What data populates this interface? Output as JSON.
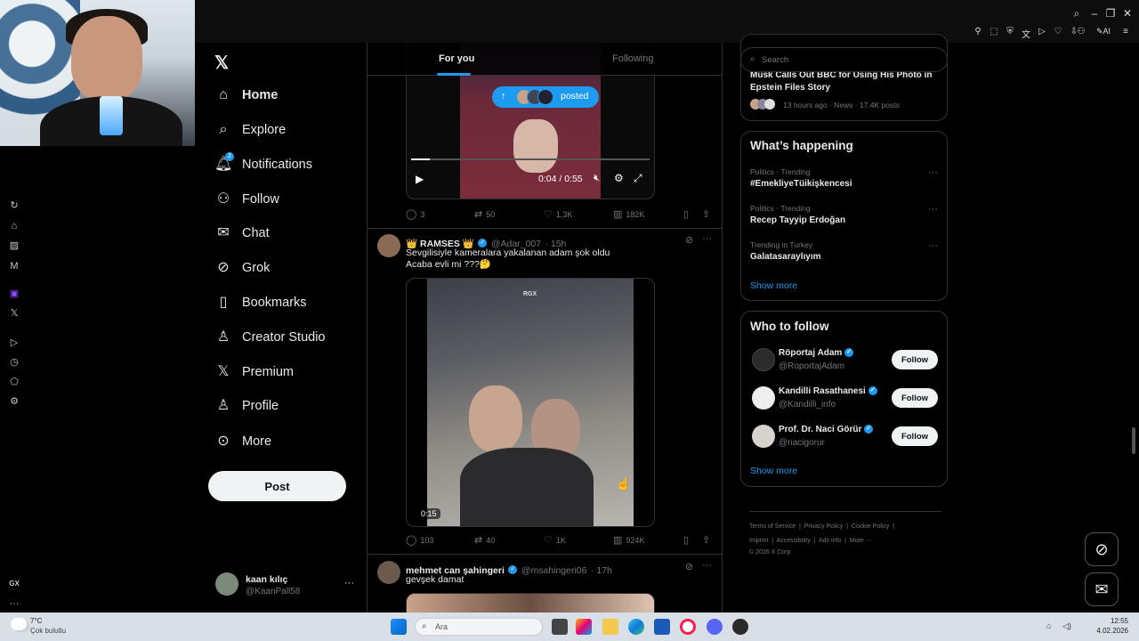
{
  "nav": {
    "items": [
      {
        "label": "Home",
        "icon": "home-icon"
      },
      {
        "label": "Explore",
        "icon": "search-icon"
      },
      {
        "label": "Notifications",
        "icon": "bell-icon",
        "badge": "2"
      },
      {
        "label": "Follow",
        "icon": "follow-icon"
      },
      {
        "label": "Chat",
        "icon": "chat-icon"
      },
      {
        "label": "Grok",
        "icon": "grok-icon"
      },
      {
        "label": "Bookmarks",
        "icon": "bookmark-icon"
      },
      {
        "label": "Creator Studio",
        "icon": "creator-studio-icon"
      },
      {
        "label": "Premium",
        "icon": "x-logo-icon"
      },
      {
        "label": "Profile",
        "icon": "profile-icon"
      },
      {
        "label": "More",
        "icon": "more-circle-icon"
      }
    ],
    "post_label": "Post",
    "account": {
      "name": "kaan kılıç",
      "handle": "@KaanPall58"
    }
  },
  "feed": {
    "tabs": [
      "For you",
      "Following"
    ],
    "posted_pill": "posted",
    "video1": {
      "time": "0:04 / 0:55",
      "progress": 0.08
    },
    "tweet1_actions": {
      "replies": "3",
      "reposts": "50",
      "likes": "1,3K",
      "views": "182K"
    },
    "tweet2": {
      "name": "👑 RAMSES 👑",
      "handle": "@Adar_007",
      "time": "· 15h",
      "text_line1": "Sevgilisiyle kameralara yakalanan adam şok oldu",
      "text_line2": "Acaba evli mi ???🤔",
      "watermark": "RGX",
      "duration": "0:15",
      "actions": {
        "replies": "103",
        "reposts": "40",
        "likes": "1K",
        "views": "924K"
      }
    },
    "tweet3": {
      "name": "mehmet can şahingeri",
      "handle": "@msahingeri06",
      "time": "· 17h",
      "text": "gevşek damat"
    }
  },
  "right": {
    "search_placeholder": "Search",
    "top_story": {
      "title_line1": "Musk Calls Out BBC for Using His Photo in",
      "title_line2": "Epstein Files Story",
      "meta": "13 hours ago · News · 17.4K posts"
    },
    "happening": {
      "title": "What’s happening",
      "trends": [
        {
          "context": "Politics · Trending",
          "name": "#EmekliyeTüikişkencesi"
        },
        {
          "context": "Politics · Trending",
          "name": "Recep Tayyip Erdoğan"
        },
        {
          "context": "Trending in Turkey",
          "name": "Galatasaraylıyım"
        }
      ],
      "show_more": "Show more"
    },
    "who_to_follow": {
      "title": "Who to follow",
      "users": [
        {
          "name": "Röportaj Adam",
          "handle": "@RoportajAdam",
          "button": "Follow"
        },
        {
          "name": "Kandilli Rasathanesi",
          "handle": "@Kandilli_info",
          "button": "Follow"
        },
        {
          "name": "Prof. Dr. Naci Görür",
          "handle": "@nacigorur",
          "button": "Follow"
        }
      ],
      "show_more": "Show more"
    },
    "footer": {
      "links": [
        "Terms of Service",
        "Privacy Policy",
        "Cookie Policy",
        "Imprint",
        "Accessibility",
        "Ads info",
        "More ···"
      ],
      "copyright": "© 2026 X Corp."
    }
  },
  "taskbar": {
    "weather_temp": "7°C",
    "weather_text": "Çok bulutlu",
    "search_placeholder": "Ara",
    "time": "12:55",
    "date": "4.02.2026"
  },
  "opera": {
    "gx_label": "GX"
  },
  "colors": {
    "accent": "#1d9bf0",
    "bg": "#000000",
    "border": "#2f3336"
  }
}
